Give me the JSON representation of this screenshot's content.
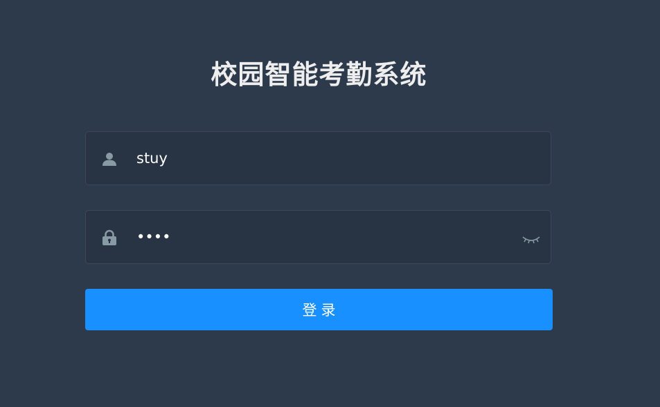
{
  "title": "校园智能考勤系统",
  "username": {
    "value": "stuy",
    "icon": "user-icon"
  },
  "password": {
    "value": "stuy",
    "icon": "lock-icon",
    "toggle_icon": "eye-closed-icon"
  },
  "login_button": {
    "label": "登录"
  },
  "colors": {
    "background": "#2d3a4b",
    "field_background": "#283443",
    "accent": "#1890ff",
    "icon": "#889aa4",
    "title": "#eeeeee"
  }
}
